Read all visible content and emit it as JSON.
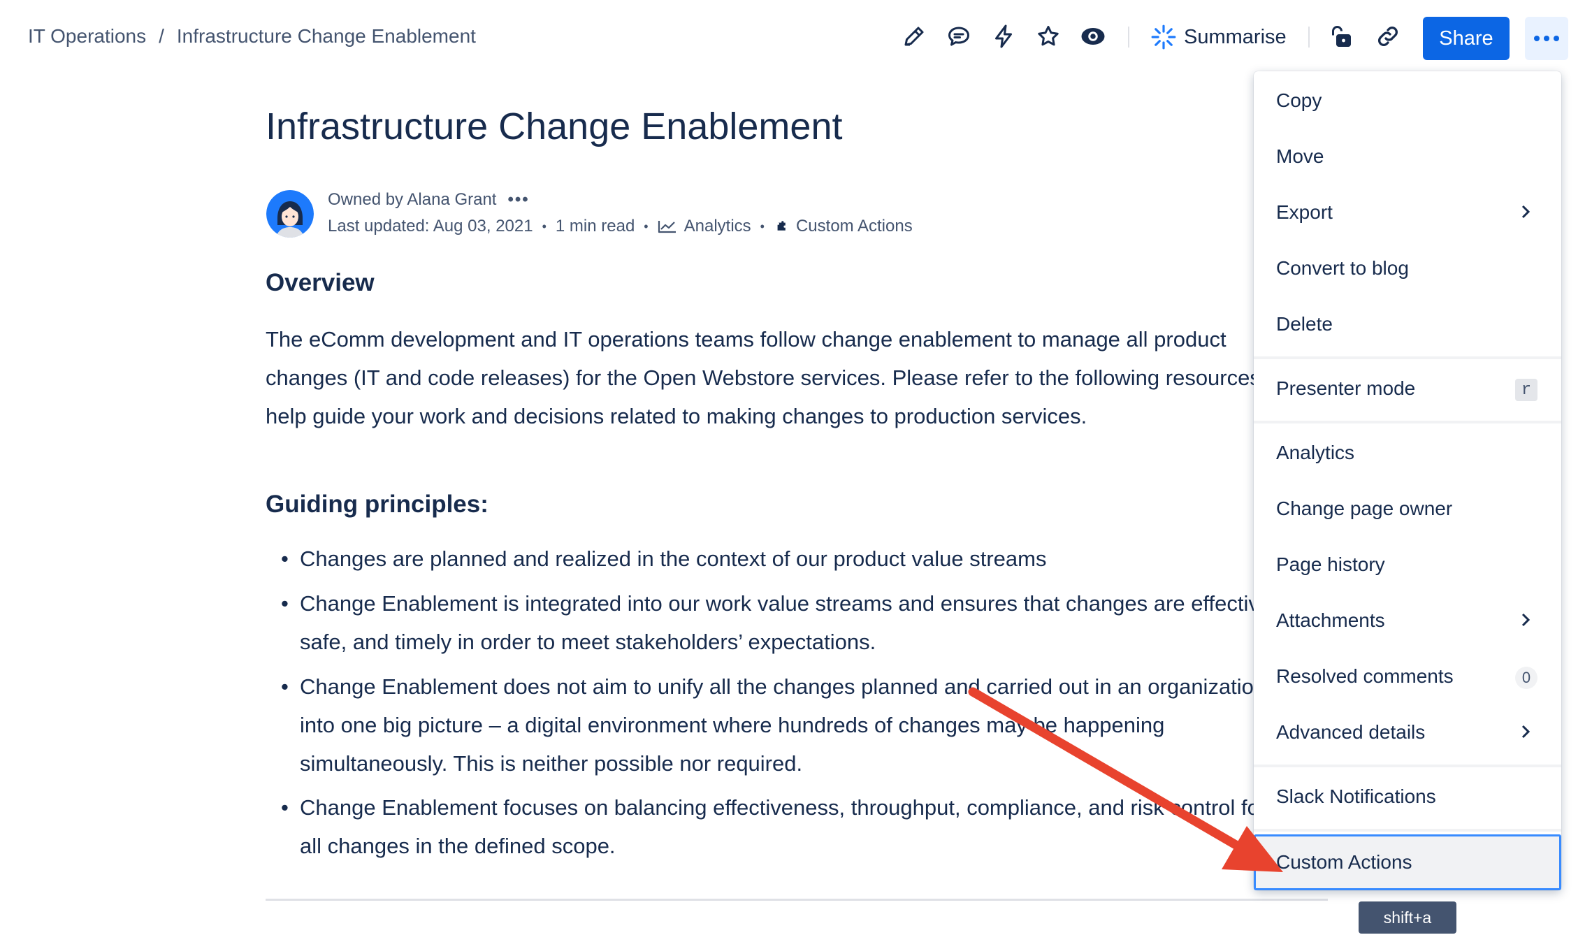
{
  "breadcrumb": {
    "space": "IT Operations",
    "separator": "/",
    "page": "Infrastructure Change Enablement"
  },
  "toolbar": {
    "icons": [
      "edit-icon",
      "comment-icon",
      "automation-icon",
      "star-icon",
      "watch-icon",
      "restrict-icon",
      "link-icon",
      "more-icon"
    ],
    "summarise_label": "Summarise",
    "share_label": "Share"
  },
  "page": {
    "title": "Infrastructure Change Enablement",
    "owner_text": "Owned by Alana Grant",
    "last_updated": "Last updated: Aug 03, 2021",
    "read_time": "1 min read",
    "analytics_link": "Analytics",
    "custom_actions_link": "Custom Actions"
  },
  "content": {
    "overview_heading": "Overview",
    "overview_lines": [
      "The eComm development and IT operations teams follow change enablement to manage all product",
      "changes (IT and code releases) for the Open Webstore services. Please refer to the following resources to",
      "help guide your work and decisions related to making changes to production services."
    ],
    "principles_heading": "Guiding principles:",
    "principles": [
      {
        "lines": [
          "Changes are planned and realized in the context of our product value streams"
        ]
      },
      {
        "lines": [
          "Change Enablement is integrated into our work value streams and ensures that changes are effective,",
          "safe, and timely in order to meet stakeholders’ expectations."
        ]
      },
      {
        "lines": [
          "Change Enablement does not aim to unify all the changes planned and carried out in an organization",
          "into one big picture – a digital environment where hundreds of changes may be happening",
          "simultaneously. This is neither possible nor required."
        ]
      },
      {
        "lines": [
          "Change Enablement focuses on balancing effectiveness, throughput, compliance, and risk control for",
          "all changes in the defined scope."
        ]
      }
    ]
  },
  "menu": {
    "items": [
      {
        "label": "Copy"
      },
      {
        "label": "Move"
      },
      {
        "label": "Export",
        "submenu": true
      },
      {
        "label": "Convert to blog"
      },
      {
        "label": "Delete"
      },
      {
        "label": "Presenter mode",
        "shortcut": "r"
      },
      {
        "label": "Analytics"
      },
      {
        "label": "Change page owner"
      },
      {
        "label": "Page history"
      },
      {
        "label": "Attachments",
        "submenu": true
      },
      {
        "label": "Resolved comments",
        "badge": "0"
      },
      {
        "label": "Advanced details",
        "submenu": true
      },
      {
        "label": "Slack Notifications"
      },
      {
        "label": "Custom Actions",
        "focused": true
      }
    ],
    "tooltip": "shift+a"
  },
  "colors": {
    "brand_blue": "#0c66e4",
    "text": "#172b4d",
    "subtle_text": "#44546f",
    "annotation_arrow": "#e8432e"
  }
}
